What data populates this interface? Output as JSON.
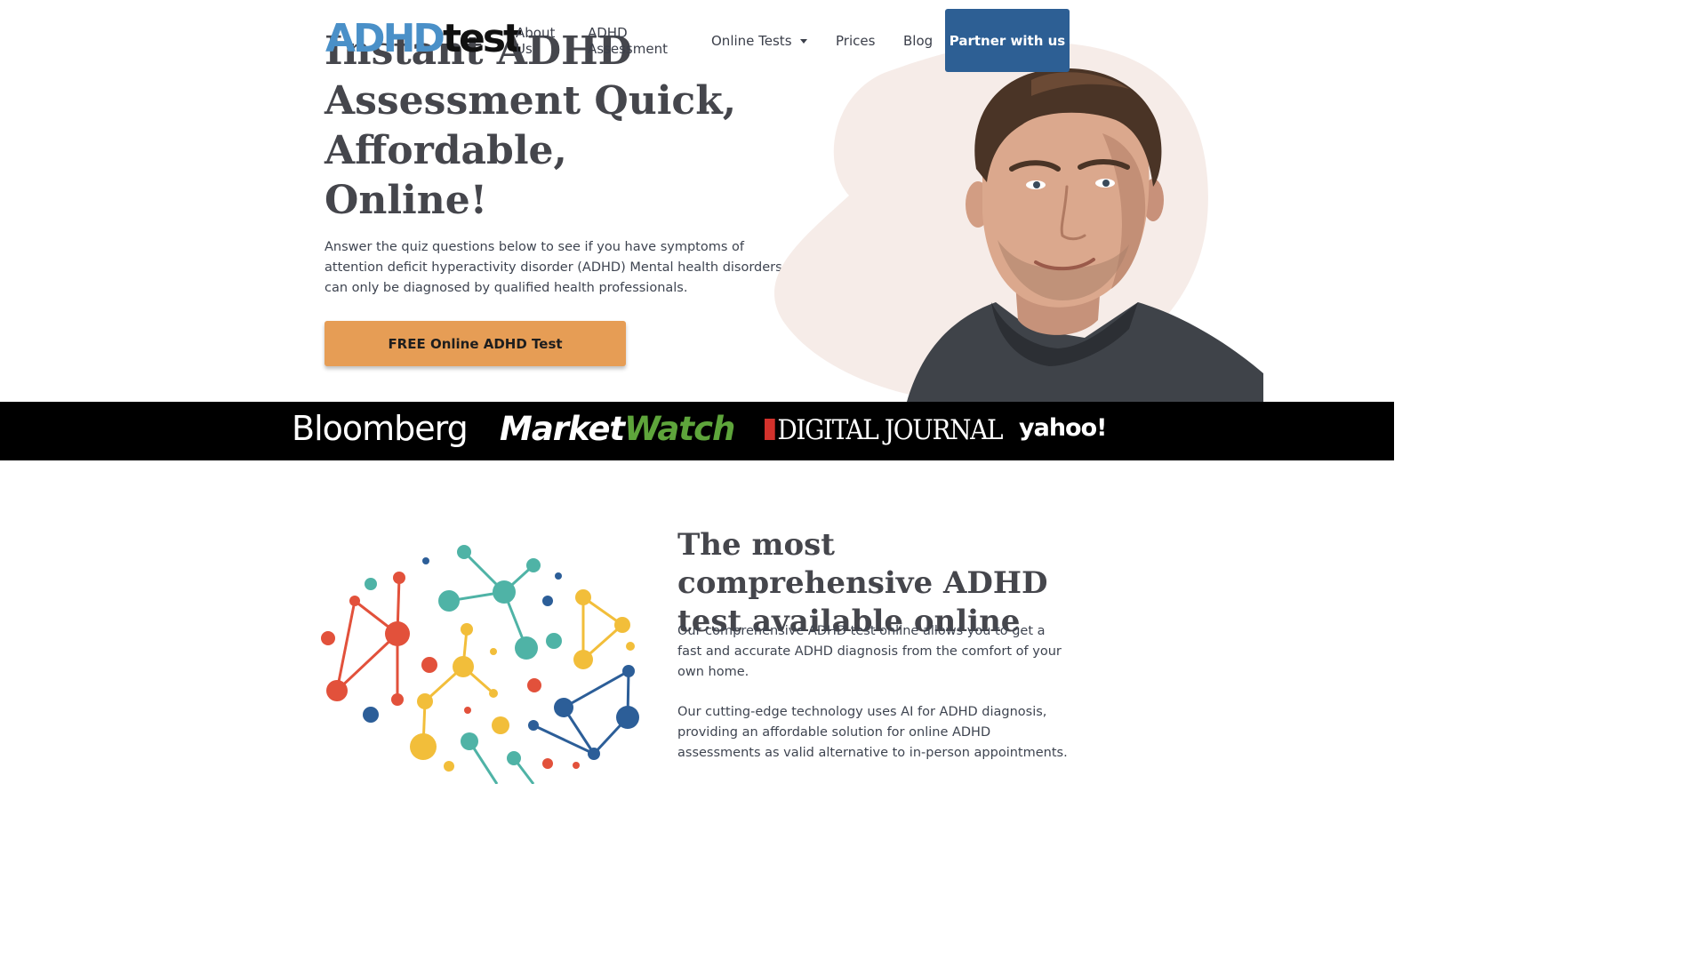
{
  "header": {
    "logo_part1": "ADHD",
    "logo_part2": "test",
    "nav": {
      "about": "About Us",
      "adhd_assessment": "ADHD Assessment",
      "online_tests": "Online Tests",
      "prices": "Prices",
      "blog": "Blog"
    },
    "partner_label": "Partner with us"
  },
  "hero": {
    "title": "Instant ADHD Assessment Quick, Affordable, Online!",
    "description": "Answer the quiz questions below to see if you have symptoms of attention deficit hyperactivity disorder (ADHD) Mental health disorders can only be diagnosed by qualified health professionals.",
    "cta_label": "FREE Online ADHD Test"
  },
  "press": {
    "bloomberg": "Bloomberg",
    "marketwatch_a": "Market",
    "marketwatch_b": "Watch",
    "digital_journal": "DIGITAL JOURNAL",
    "yahoo": "yahoo!"
  },
  "section": {
    "title": "The most comprehensive ADHD test available online",
    "paragraph1": "Our comprehensive ADHD test online allows you to get a fast and accurate ADHD diagnosis from the comfort of your own home.",
    "paragraph2": "Our cutting-edge technology uses AI for ADHD diagnosis, providing an affordable solution for online ADHD assessments as valid alternative to in-person appointments."
  },
  "colors": {
    "brand_blue": "#2d5f94",
    "logo_blue": "#4a90c8",
    "cta_orange": "#e69d55",
    "blob_pink": "#f6ece8",
    "heading": "#45464c"
  }
}
